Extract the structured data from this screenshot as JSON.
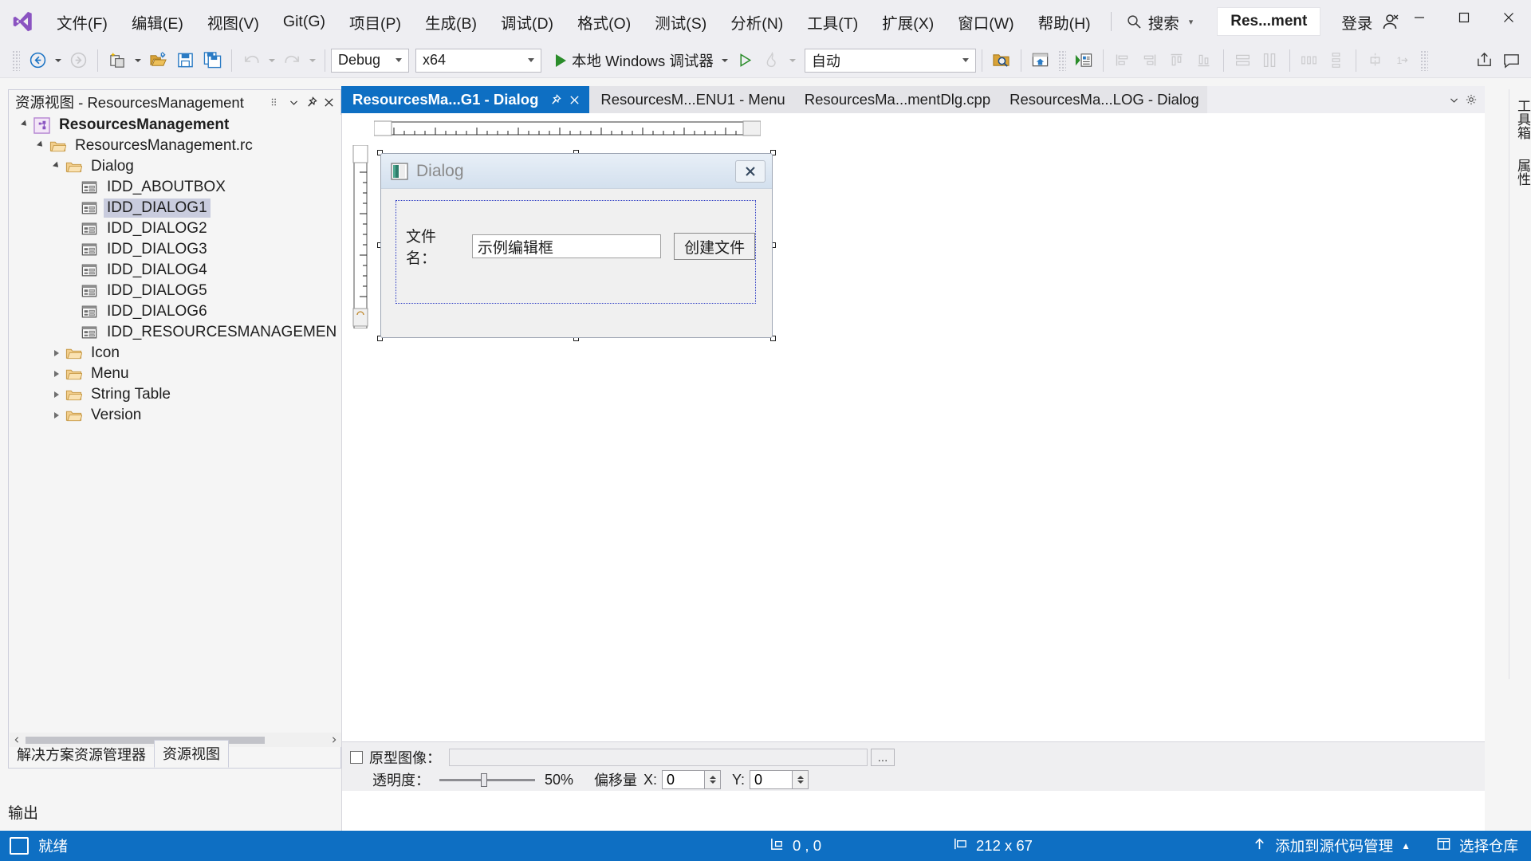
{
  "titlebar": {
    "logo_icon": "visual-studio-logo",
    "menus": [
      {
        "label": "文件(F)"
      },
      {
        "label": "编辑(E)"
      },
      {
        "label": "视图(V)"
      },
      {
        "label": "Git(G)"
      },
      {
        "label": "项目(P)"
      },
      {
        "label": "生成(B)"
      },
      {
        "label": "调试(D)"
      },
      {
        "label": "格式(O)"
      },
      {
        "label": "测试(S)"
      },
      {
        "label": "分析(N)"
      },
      {
        "label": "工具(T)"
      },
      {
        "label": "扩展(X)"
      },
      {
        "label": "窗口(W)"
      },
      {
        "label": "帮助(H)"
      }
    ],
    "search": {
      "label": "搜索",
      "icon": "search-icon"
    },
    "project_chip": "Res...ment",
    "signin": "登录",
    "window_controls": {
      "minimize": "minimize-icon",
      "maximize": "maximize-icon",
      "close": "close-icon"
    }
  },
  "toolbar": {
    "nav_back_icon": "navigate-back-icon",
    "nav_forward_icon": "navigate-forward-icon",
    "new_item_icon": "new-item-icon",
    "open_icon": "open-file-icon",
    "save_icon": "save-icon",
    "save_all_icon": "save-all-icon",
    "undo_icon": "undo-icon",
    "redo_icon": "redo-icon",
    "configuration": "Debug",
    "platform": "x64",
    "run_label": "本地 Windows 调试器",
    "hot_reload_icon": "hot-reload-icon",
    "start_icon": "start-debug-icon",
    "auto_select": "自动",
    "find_in_files_icon": "find-in-files-icon",
    "home_window_icon": "home-window-icon",
    "preview_icon": "preview-icon",
    "align_icons": [
      "align-left-icon",
      "align-center-icon",
      "align-top-icon",
      "align-bottom-icon",
      "space-horizontal-icon",
      "space-vertical-icon",
      "same-width-icon",
      "same-height-icon",
      "center-horizontal-icon",
      "tab-order-icon"
    ],
    "share_icon": "share-icon",
    "feedback_icon": "feedback-icon"
  },
  "left_panel": {
    "title": "资源视图 - ResourcesManagement",
    "toolbar_icons": [
      "more-options-icon",
      "pin-icon",
      "close-icon"
    ],
    "tree": [
      {
        "label": "ResourcesManagement",
        "level": 0,
        "twist": "open",
        "icon": "project-icon",
        "bold": true,
        "selected": false
      },
      {
        "label": "ResourcesManagement.rc",
        "level": 1,
        "twist": "open",
        "icon": "folder-icon",
        "bold": false,
        "selected": false
      },
      {
        "label": "Dialog",
        "level": 2,
        "twist": "open",
        "icon": "folder-icon",
        "bold": false,
        "selected": false
      },
      {
        "label": "IDD_ABOUTBOX",
        "level": 3,
        "twist": "none",
        "icon": "dialog-resource-icon",
        "bold": false,
        "selected": false
      },
      {
        "label": "IDD_DIALOG1",
        "level": 3,
        "twist": "none",
        "icon": "dialog-resource-icon",
        "bold": false,
        "selected": true
      },
      {
        "label": "IDD_DIALOG2",
        "level": 3,
        "twist": "none",
        "icon": "dialog-resource-icon",
        "bold": false,
        "selected": false
      },
      {
        "label": "IDD_DIALOG3",
        "level": 3,
        "twist": "none",
        "icon": "dialog-resource-icon",
        "bold": false,
        "selected": false
      },
      {
        "label": "IDD_DIALOG4",
        "level": 3,
        "twist": "none",
        "icon": "dialog-resource-icon",
        "bold": false,
        "selected": false
      },
      {
        "label": "IDD_DIALOG5",
        "level": 3,
        "twist": "none",
        "icon": "dialog-resource-icon",
        "bold": false,
        "selected": false
      },
      {
        "label": "IDD_DIALOG6",
        "level": 3,
        "twist": "none",
        "icon": "dialog-resource-icon",
        "bold": false,
        "selected": false
      },
      {
        "label": "IDD_RESOURCESMANAGEMEN",
        "level": 3,
        "twist": "none",
        "icon": "dialog-resource-icon",
        "bold": false,
        "selected": false
      },
      {
        "label": "Icon",
        "level": 2,
        "twist": "closed",
        "icon": "folder-icon",
        "bold": false,
        "selected": false
      },
      {
        "label": "Menu",
        "level": 2,
        "twist": "closed",
        "icon": "folder-icon",
        "bold": false,
        "selected": false
      },
      {
        "label": "String Table",
        "level": 2,
        "twist": "closed",
        "icon": "folder-icon",
        "bold": false,
        "selected": false
      },
      {
        "label": "Version",
        "level": 2,
        "twist": "closed",
        "icon": "folder-icon",
        "bold": false,
        "selected": false
      }
    ],
    "bottom_tabs": [
      {
        "label": "解决方案资源管理器",
        "active": false
      },
      {
        "label": "资源视图",
        "active": true
      }
    ]
  },
  "editor": {
    "tabs": [
      {
        "label": "ResourcesMa...G1 - Dialog",
        "active": true,
        "closable": true,
        "pinnable": true
      },
      {
        "label": "ResourcesM...ENU1 - Menu",
        "active": false,
        "closable": false,
        "pinnable": false
      },
      {
        "label": "ResourcesMa...mentDlg.cpp",
        "active": false,
        "closable": false,
        "pinnable": false
      },
      {
        "label": "ResourcesMa...LOG - Dialog",
        "active": false,
        "closable": false,
        "pinnable": false
      }
    ],
    "tabstrip_icons": [
      "chevron-down-icon",
      "tab-settings-icon"
    ],
    "dialog_preview": {
      "title": "Dialog",
      "icon": "dialog-window-icon",
      "close_icon": "close-icon",
      "groupbox_border_color": "#2C3BC4",
      "label": "文件名：",
      "edit_value": "示例编辑框",
      "button_label": "创建文件"
    }
  },
  "prototype_bar": {
    "checkbox_label": "原型图像：",
    "path_value": "",
    "browse_label": "...",
    "opacity_label": "透明度：",
    "opacity_value": "50%",
    "offset_label": "偏移量",
    "offset_x_label": "X:",
    "offset_x_value": "0",
    "offset_y_label": "Y:",
    "offset_y_value": "0"
  },
  "right_dock": {
    "tabs": [
      {
        "label": "工具箱"
      },
      {
        "label": "属性"
      }
    ]
  },
  "output_panel": {
    "label": "输出"
  },
  "statusbar": {
    "status_icon": "ready-icon",
    "status": "就绪",
    "position_icon": "position-icon",
    "position": "0 , 0",
    "size_icon": "size-icon",
    "size": "212 x 67",
    "source_control_icon": "add-to-source-control-icon",
    "source_control": "添加到源代码管理",
    "source_control_caret": "▲",
    "repo_icon": "repository-icon",
    "repo": "选择仓库",
    "accent_color": "#0E6FC3"
  }
}
